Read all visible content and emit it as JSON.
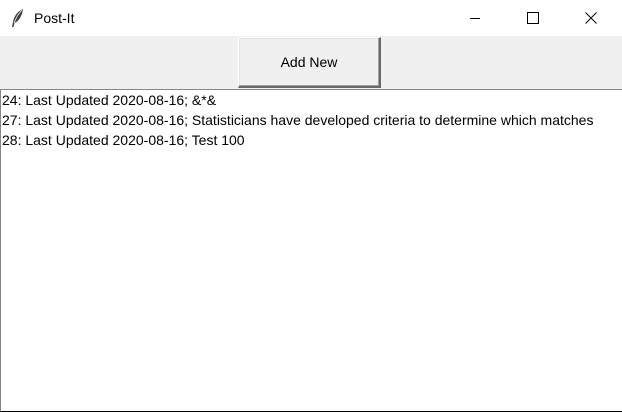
{
  "window": {
    "title": "Post-It",
    "app_icon": "feather-icon"
  },
  "controls": {
    "minimize_icon": "minimize-icon",
    "maximize_icon": "maximize-icon",
    "close_icon": "close-icon"
  },
  "toolbar": {
    "add_label": "Add New"
  },
  "notes": [
    {
      "text": "24: Last Updated 2020-08-16; &*&"
    },
    {
      "text": "27: Last Updated 2020-08-16; Statisticians have developed criteria to determine which matches"
    },
    {
      "text": "28: Last Updated 2020-08-16; Test 100"
    }
  ]
}
